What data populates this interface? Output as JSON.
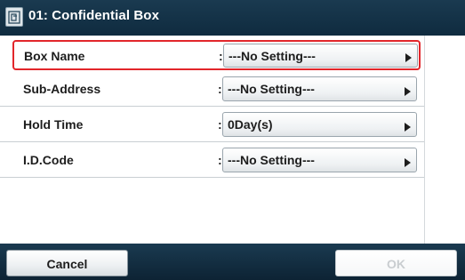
{
  "header": {
    "title": "01: Confidential Box",
    "icon": "box-document-icon"
  },
  "fields": [
    {
      "label": "Box Name",
      "value": "---No Setting---",
      "selected": true
    },
    {
      "label": "Sub-Address",
      "value": "---No Setting---",
      "selected": false
    },
    {
      "label": "Hold Time",
      "value": "0Day(s)",
      "selected": false
    },
    {
      "label": "I.D.Code",
      "value": "---No Setting---",
      "selected": false
    }
  ],
  "separator": ":",
  "footer": {
    "cancel_label": "Cancel",
    "ok_label": "OK",
    "ok_enabled": false
  },
  "colors": {
    "header_bg": "#0f2b3f",
    "selection_border": "#e2262b",
    "disabled_text": "#c9cdd0"
  }
}
